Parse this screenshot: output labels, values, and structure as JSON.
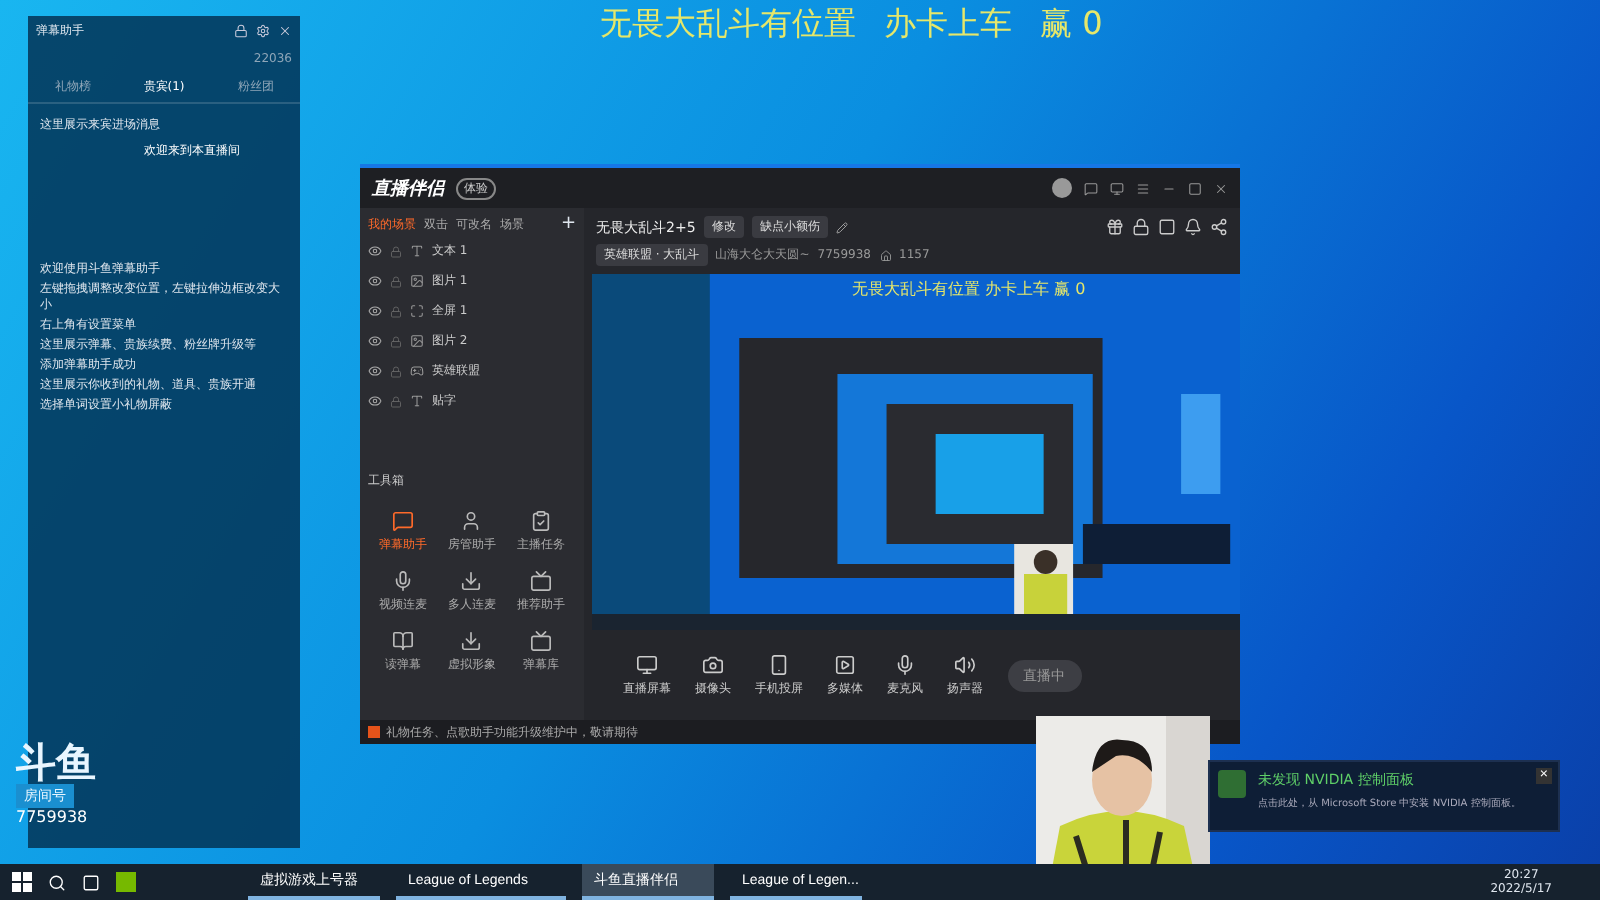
{
  "overlay_caption": [
    "无畏大乱斗有位置",
    "办卡上车",
    "赢 0"
  ],
  "danmu_panel": {
    "title": "弹幕助手",
    "stat": "22036",
    "tabs": [
      {
        "label": "礼物榜",
        "selected": false
      },
      {
        "label": "贵宾(1)",
        "selected": true
      },
      {
        "label": "粉丝团",
        "selected": false
      }
    ],
    "messages": [
      {
        "kind": "system",
        "text": "这里展示来宾进场消息"
      },
      {
        "kind": "guest",
        "text": "欢迎来到本直播间"
      },
      {
        "kind": "system",
        "text": "欢迎使用斗鱼弹幕助手"
      },
      {
        "kind": "system",
        "text": "左键拖拽调整改变位置，左键拉伸边框改变大小"
      },
      {
        "kind": "system",
        "text": "右上角有设置菜单"
      },
      {
        "kind": "system",
        "text": "这里展示弹幕、贵族续费、粉丝牌升级等"
      },
      {
        "kind": "system",
        "text": "添加弹幕助手成功"
      },
      {
        "kind": "system",
        "text": "这里展示你收到的礼物、道具、贵族开通"
      },
      {
        "kind": "system",
        "text": "选择单词设置小礼物屏蔽"
      }
    ]
  },
  "douyu_logo": {
    "brand": "斗鱼",
    "label": "房间号",
    "room": "7759938"
  },
  "app": {
    "title": "直播伴侣",
    "badge": "体验",
    "scene_tabs": [
      {
        "label": "我的场景",
        "selected": true
      },
      {
        "label": "双击",
        "selected": false
      },
      {
        "label": "可改名",
        "selected": false
      },
      {
        "label": "场景",
        "selected": false
      }
    ],
    "add": "+",
    "sources": [
      {
        "label": "文本 1"
      },
      {
        "label": "图片 1"
      },
      {
        "label": "全屏 1"
      },
      {
        "label": "图片 2"
      },
      {
        "label": "英雄联盟"
      },
      {
        "label": "贴字"
      }
    ],
    "toolbox_title": "工具箱",
    "tools": [
      {
        "label": "弹幕助手",
        "active": true
      },
      {
        "label": "房管助手",
        "active": false
      },
      {
        "label": "主播任务",
        "active": false
      },
      {
        "label": "视频连麦",
        "active": false
      },
      {
        "label": "多人连麦",
        "active": false
      },
      {
        "label": "推荐助手",
        "active": false
      },
      {
        "label": "读弹幕",
        "active": false
      },
      {
        "label": "虚拟形象",
        "active": false
      },
      {
        "label": "弹幕库",
        "active": false
      }
    ],
    "room_title": "无畏大乱斗2+5",
    "edit_tag": "修改",
    "notice": "缺点小额伤",
    "category": "英雄联盟 · 大乱斗",
    "location": "山海大仑大天圆~",
    "room_id": "7759938",
    "viewers": "1157",
    "preview_caption": "无畏大乱斗有位置  办卡上车  赢 0",
    "controls": [
      {
        "label": "直播屏幕"
      },
      {
        "label": "摄像头"
      },
      {
        "label": "手机投屏"
      },
      {
        "label": "多媒体"
      },
      {
        "label": "麦克风"
      },
      {
        "label": "扬声器"
      }
    ],
    "live_button": "直播中",
    "status": "礼物任务、点歌助手功能升级维护中，敬请期待"
  },
  "notification": {
    "title": "未发现 NVIDIA 控制面板",
    "body": "点击此处，从 Microsoft Store 中安装 NVIDIA 控制面板。",
    "close": "×"
  },
  "taskbar": {
    "apps": [
      {
        "label": "虚拟游戏上号器",
        "selected": false
      },
      {
        "label": "League of Legends",
        "selected": false
      },
      {
        "label": "斗鱼直播伴侣",
        "selected": true
      },
      {
        "label": "League of Legen...",
        "selected": false
      }
    ],
    "time": "20:27",
    "date": "2022/5/17"
  }
}
